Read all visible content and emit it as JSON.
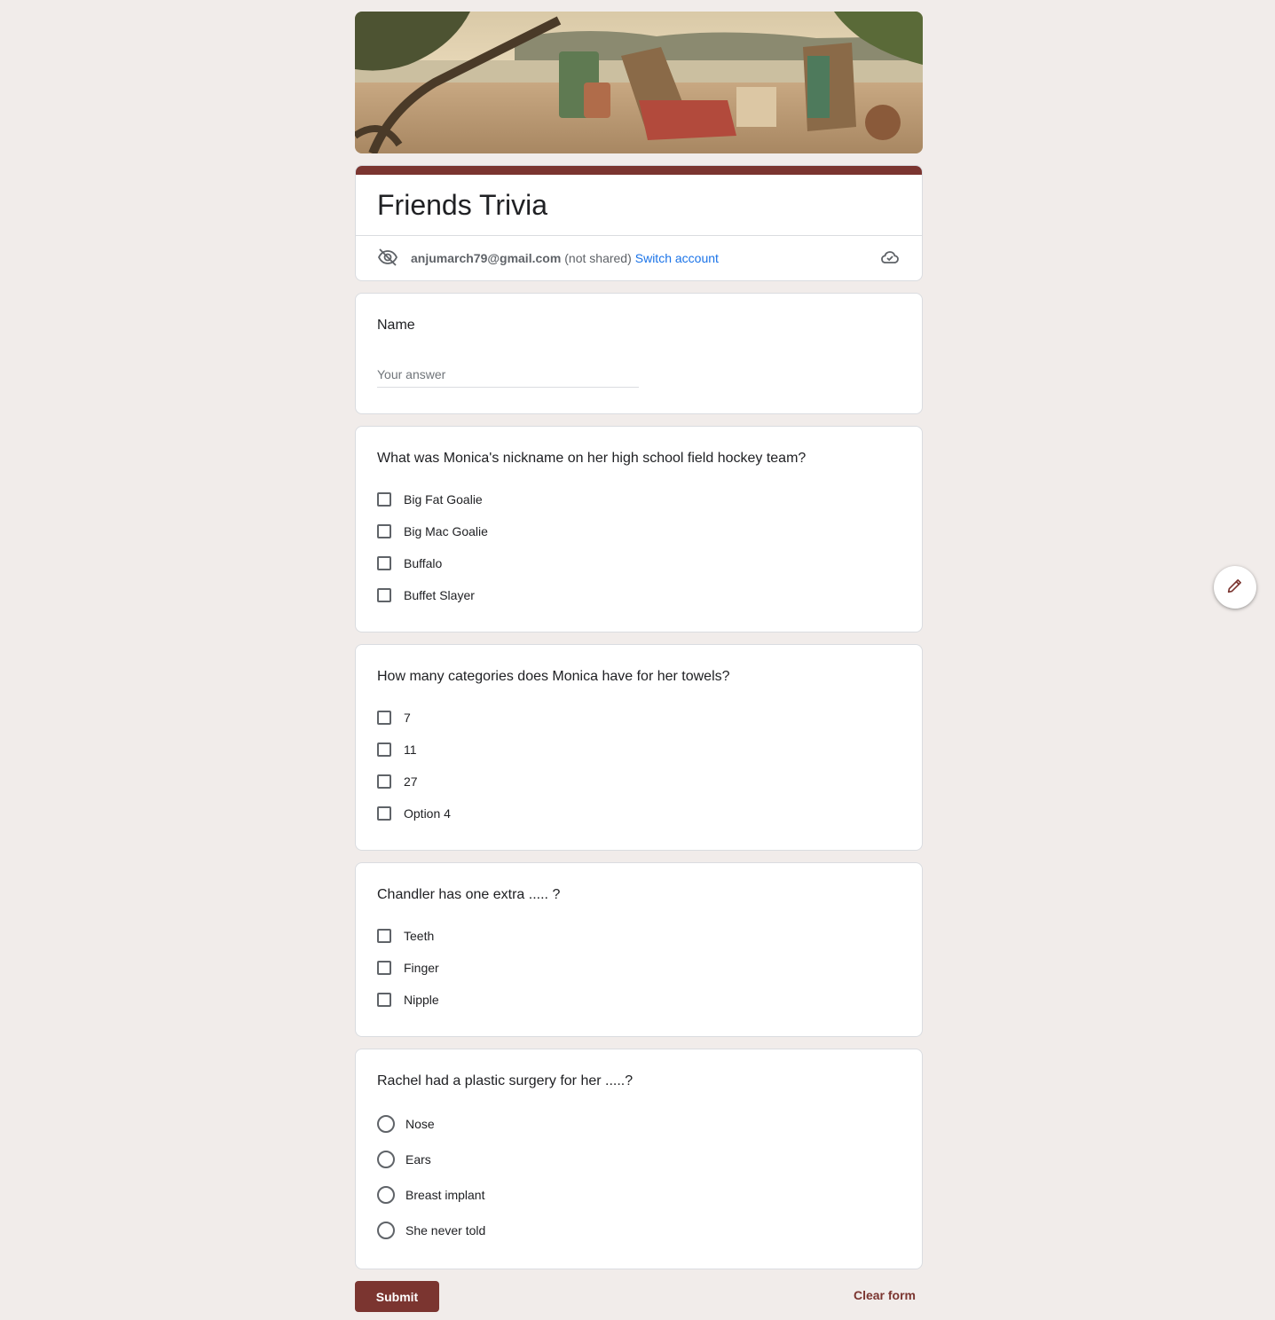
{
  "form": {
    "title": "Friends Trivia",
    "account_email": "anjumarch79@gmail.com",
    "not_shared": "(not shared)",
    "switch_account": "Switch account",
    "accent_color": "#7b3530"
  },
  "name_question": {
    "title": "Name",
    "placeholder": "Your answer",
    "value": ""
  },
  "questions": [
    {
      "title": "What was Monica's nickname on her high school field hockey team?",
      "type": "checkbox",
      "options": [
        "Big Fat Goalie",
        "Big Mac Goalie",
        "Buffalo",
        "Buffet Slayer"
      ]
    },
    {
      "title": "How many categories does Monica have for her towels?",
      "type": "checkbox",
      "options": [
        "7",
        "11",
        "27",
        "Option 4"
      ]
    },
    {
      "title": "Chandler has one extra ..... ?",
      "type": "checkbox",
      "options": [
        "Teeth",
        "Finger",
        "Nipple"
      ]
    },
    {
      "title": "Rachel had a plastic surgery for her .....?",
      "type": "radio",
      "options": [
        "Nose",
        "Ears",
        "Breast implant",
        "She never told"
      ]
    }
  ],
  "footer": {
    "submit_label": "Submit",
    "clear_label": "Clear form"
  },
  "icons": {
    "visibility_off": "eye-off-icon",
    "cloud": "cloud-saved-icon",
    "edit": "pencil-icon"
  }
}
